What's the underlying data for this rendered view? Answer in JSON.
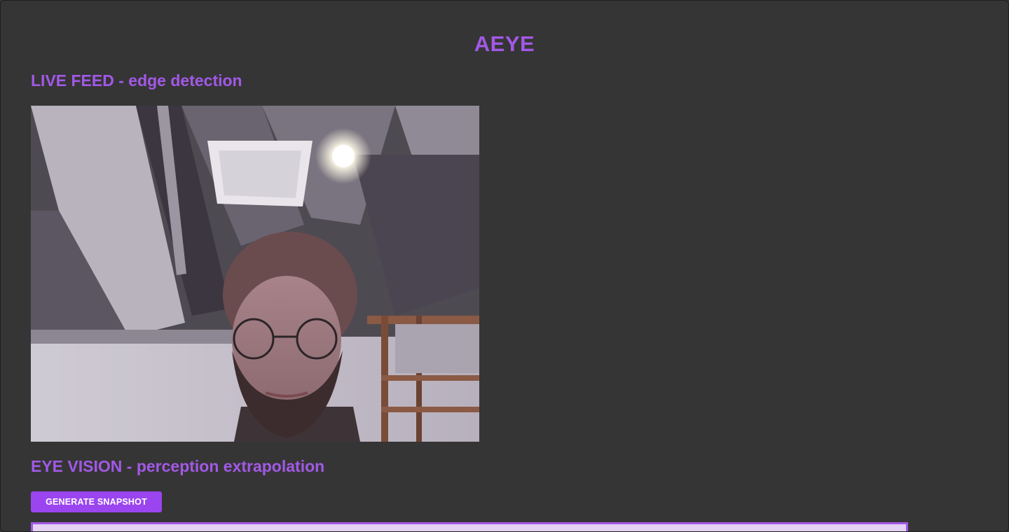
{
  "app": {
    "title": "AEYE"
  },
  "live_feed": {
    "heading": "LIVE FEED - edge detection",
    "image": "webcam-frame"
  },
  "eye_vision": {
    "heading": "EYE VISION - perception extrapolation",
    "button_label": "GENERATE SNAPSHOT"
  },
  "colors": {
    "background": "#353535",
    "accent": "#a259e6",
    "button": "#9b45f0",
    "output_box": "#e3d2f3"
  }
}
